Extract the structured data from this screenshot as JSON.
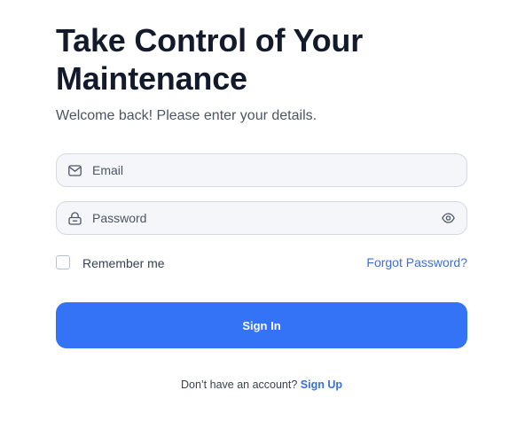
{
  "header": {
    "title": "Take Control of Your Maintenance",
    "subtitle": "Welcome back! Please enter your details."
  },
  "form": {
    "email": {
      "placeholder": "Email",
      "value": "",
      "icon": "mail-icon"
    },
    "password": {
      "placeholder": "Password",
      "value": "",
      "icon": "lock-icon",
      "toggle_icon": "eye-icon"
    },
    "remember_label": "Remember me",
    "remember_checked": false,
    "forgot_label": "Forgot Password?",
    "submit_label": "Sign In"
  },
  "footer": {
    "prompt": "Don’t have an account?",
    "signup_label": "Sign Up"
  },
  "colors": {
    "primary": "#3473f6",
    "link": "#3b6fd8",
    "input_bg": "#f4f6fa",
    "title": "#121a2b"
  }
}
